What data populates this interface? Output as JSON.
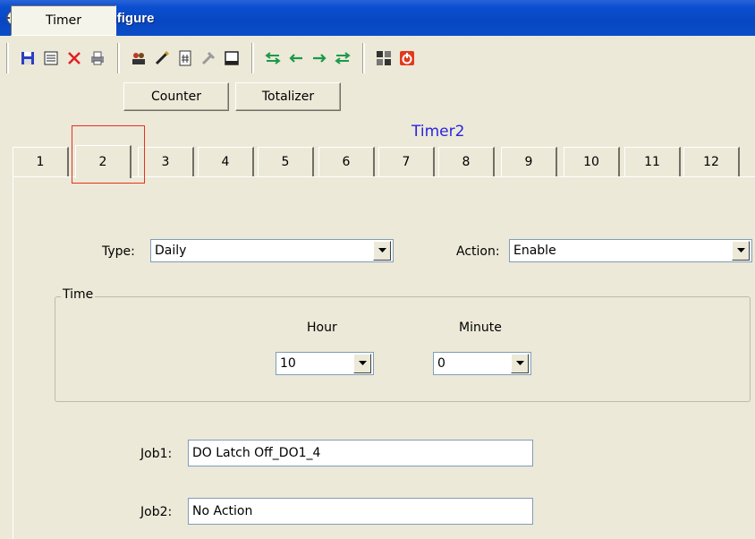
{
  "window": {
    "title": "RealTime Configure",
    "icon": "app-gear-icon"
  },
  "toolbar": {
    "groups": [
      [
        "save-icon",
        "list-icon",
        "delete-icon",
        "print-icon"
      ],
      [
        "users-icon",
        "edit-icon",
        "hash-doc-icon",
        "tools-icon",
        "window-icon"
      ],
      [
        "first-icon",
        "prev-icon",
        "next-icon",
        "last-icon"
      ],
      [
        "network-icon",
        "power-icon"
      ]
    ]
  },
  "mode_tabs": [
    {
      "label": "Timer",
      "active": true
    },
    {
      "label": "Counter",
      "active": false
    },
    {
      "label": "Totalizer",
      "active": false
    }
  ],
  "timer_heading": "Timer2",
  "number_tabs": [
    "1",
    "2",
    "3",
    "4",
    "5",
    "6",
    "7",
    "8",
    "9",
    "10",
    "11",
    "12"
  ],
  "active_number_tab": "2",
  "form": {
    "type_label": "Type:",
    "type_value": "Daily",
    "action_label": "Action:",
    "action_value": "Enable",
    "time_group_label": "Time",
    "hour_label": "Hour",
    "hour_value": "10",
    "minute_label": "Minute",
    "minute_value": "0",
    "job1_label": "Job1:",
    "job1_value": "DO Latch Off_DO1_4",
    "job2_label": "Job2:",
    "job2_value": "No Action"
  },
  "colors": {
    "title_bar": "#0a4fd0",
    "heading_text": "#2a24e0",
    "highlight": "#e8301d"
  }
}
